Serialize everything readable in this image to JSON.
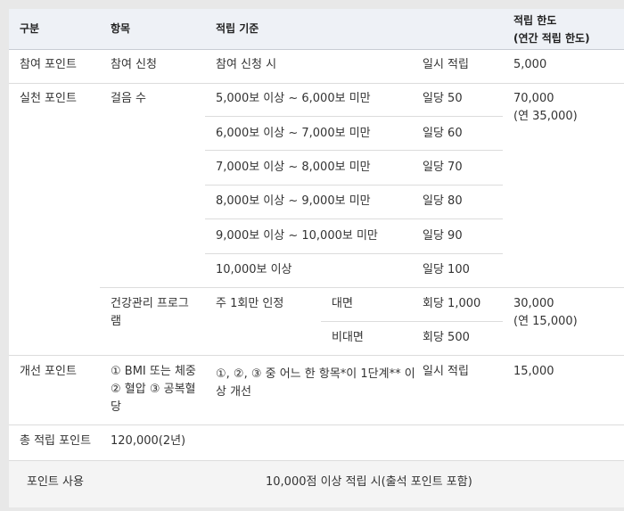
{
  "header": {
    "col1": "구분",
    "col2": "항목",
    "col3": "적립 기준",
    "col5_line1": "적립 한도",
    "col5_line2": "(연간 적립 한도)"
  },
  "rows": {
    "join": {
      "category": "참여 포인트",
      "item": "참여 신청",
      "criteria": "참여 신청 시",
      "points": "일시 적립",
      "limit": "5,000"
    },
    "practice": {
      "category": "실천 포인트",
      "walk_item": "걸음 수",
      "walk_rows": [
        {
          "criteria": "5,000보 이상 ~ 6,000보 미만",
          "points": "일당 50"
        },
        {
          "criteria": "6,000보 이상 ~ 7,000보 미만",
          "points": "일당 60"
        },
        {
          "criteria": "7,000보 이상 ~ 8,000보 미만",
          "points": "일당 70"
        },
        {
          "criteria": "8,000보 이상 ~ 9,000보 미만",
          "points": "일당 80"
        },
        {
          "criteria": "9,000보 이상 ~ 10,000보 미만",
          "points": "일당 90"
        },
        {
          "criteria": "10,000보 이상",
          "points": "일당 100"
        }
      ],
      "walk_limit_line1": "70,000",
      "walk_limit_line2": "(연 35,000)",
      "program_item_line1": "건강관리 프로그",
      "program_item_line2": "램",
      "program_criteria": "주 1회만 인정",
      "program_rows": [
        {
          "mode": "대면",
          "points": "회당 1,000"
        },
        {
          "mode": "비대면",
          "points": "회당 500"
        }
      ],
      "program_limit_line1": "30,000",
      "program_limit_line2": "(연 15,000)"
    },
    "improve": {
      "category": "개선 포인트",
      "item_line1": "① BMI 또는 체중",
      "item_line2": "② 혈압 ③ 공복혈",
      "item_line3": "당",
      "criteria_line1": "①, ②, ③ 중 어느 한 항목*이 1단계** 이",
      "criteria_line2": "상 개선",
      "points": "일시 적립",
      "limit": "15,000"
    },
    "total": {
      "category": "총 적립 포인트",
      "value": "120,000(2년)"
    }
  },
  "footer": {
    "label": "포인트 사용",
    "value": "10,000점 이상 적립 시(출석 포인트 포함)"
  }
}
